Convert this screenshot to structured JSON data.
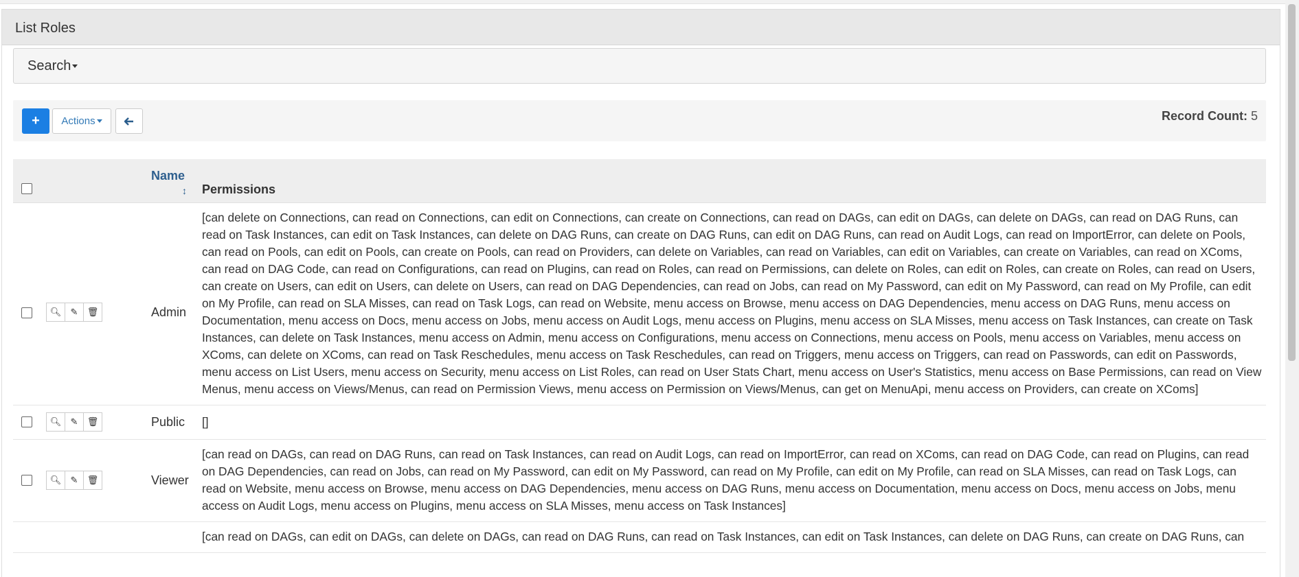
{
  "panel": {
    "title": "List Roles"
  },
  "search": {
    "label": "Search"
  },
  "toolbar": {
    "add_label": "+",
    "actions_label": "Actions",
    "back_label": "🡐",
    "record_count_label": "Record Count:",
    "record_count_value": "5"
  },
  "table": {
    "headers": {
      "name": "Name",
      "permissions": "Permissions"
    },
    "rows": [
      {
        "name": "Admin",
        "permissions": "[can delete on Connections, can read on Connections, can edit on Connections, can create on Connections, can read on DAGs, can edit on DAGs, can delete on DAGs, can read on DAG Runs, can read on Task Instances, can edit on Task Instances, can delete on DAG Runs, can create on DAG Runs, can edit on DAG Runs, can read on Audit Logs, can read on ImportError, can delete on Pools, can read on Pools, can edit on Pools, can create on Pools, can read on Providers, can delete on Variables, can read on Variables, can edit on Variables, can create on Variables, can read on XComs, can read on DAG Code, can read on Configurations, can read on Plugins, can read on Roles, can read on Permissions, can delete on Roles, can edit on Roles, can create on Roles, can read on Users, can create on Users, can edit on Users, can delete on Users, can read on DAG Dependencies, can read on Jobs, can read on My Password, can edit on My Password, can read on My Profile, can edit on My Profile, can read on SLA Misses, can read on Task Logs, can read on Website, menu access on Browse, menu access on DAG Dependencies, menu access on DAG Runs, menu access on Documentation, menu access on Docs, menu access on Jobs, menu access on Audit Logs, menu access on Plugins, menu access on SLA Misses, menu access on Task Instances, can create on Task Instances, can delete on Task Instances, menu access on Admin, menu access on Configurations, menu access on Connections, menu access on Pools, menu access on Variables, menu access on XComs, can delete on XComs, can read on Task Reschedules, menu access on Task Reschedules, can read on Triggers, menu access on Triggers, can read on Passwords, can edit on Passwords, menu access on List Users, menu access on Security, menu access on List Roles, can read on User Stats Chart, menu access on User's Statistics, menu access on Base Permissions, can read on View Menus, menu access on Views/Menus, can read on Permission Views, menu access on Permission on Views/Menus, can get on MenuApi, menu access on Providers, can create on XComs]"
      },
      {
        "name": "Public",
        "permissions": "[]"
      },
      {
        "name": "Viewer",
        "permissions": "[can read on DAGs, can read on DAG Runs, can read on Task Instances, can read on Audit Logs, can read on ImportError, can read on XComs, can read on DAG Code, can read on Plugins, can read on DAG Dependencies, can read on Jobs, can read on My Password, can edit on My Password, can read on My Profile, can edit on My Profile, can read on SLA Misses, can read on Task Logs, can read on Website, menu access on Browse, menu access on DAG Dependencies, menu access on DAG Runs, menu access on Documentation, menu access on Docs, menu access on Jobs, menu access on Audit Logs, menu access on Plugins, menu access on SLA Misses, menu access on Task Instances]"
      },
      {
        "name": "",
        "permissions": "[can read on DAGs, can edit on DAGs, can delete on DAGs, can read on DAG Runs, can read on Task Instances, can edit on Task Instances, can delete on DAG Runs, can create on DAG Runs, can"
      }
    ]
  },
  "icons": {
    "add": "plus-icon",
    "back": "arrow-left-icon",
    "show": "search-icon",
    "edit": "edit-icon",
    "delete": "trash-icon",
    "sort": "sort-icon"
  }
}
